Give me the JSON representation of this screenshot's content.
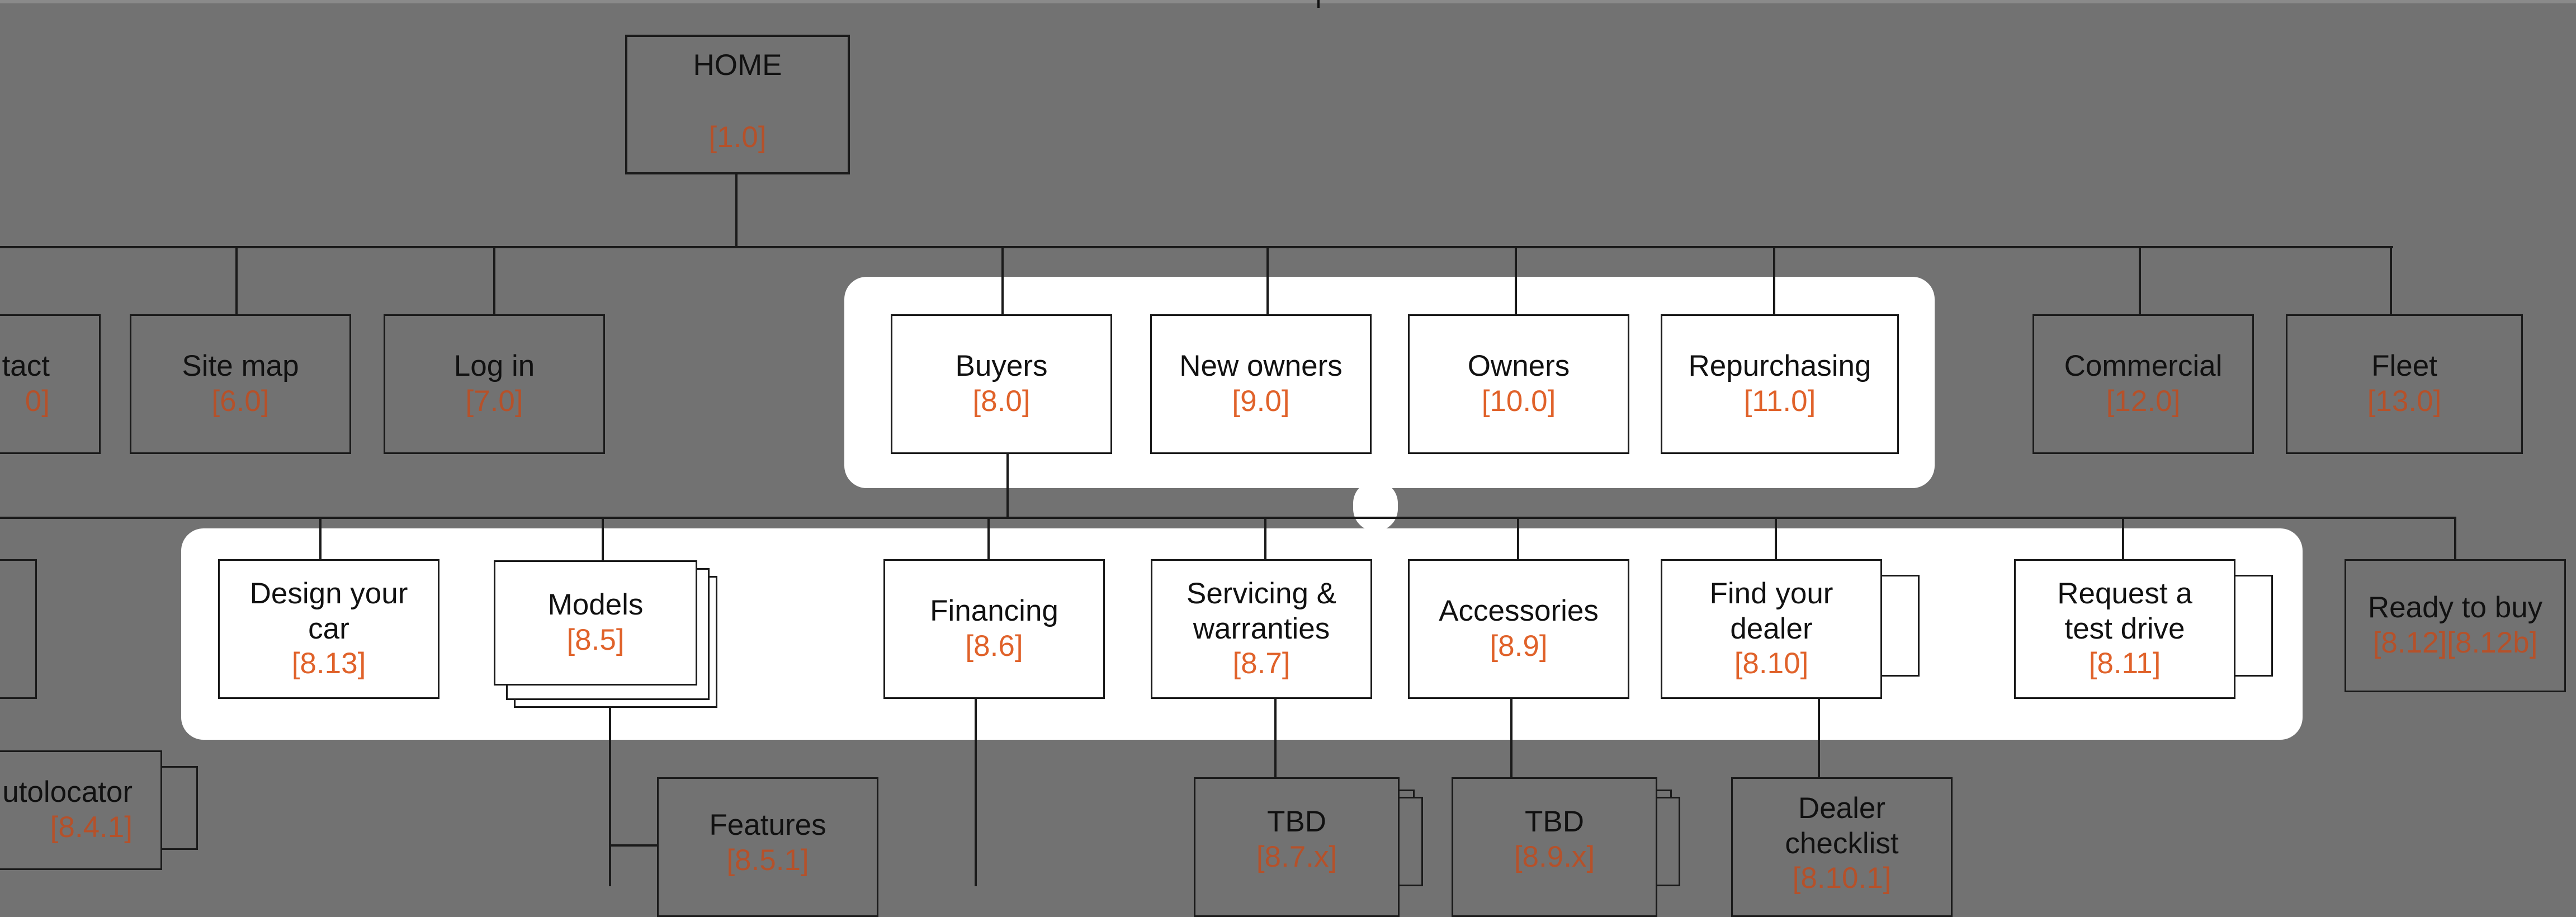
{
  "nodes": {
    "home": {
      "title": "HOME",
      "code": "[1.0]"
    },
    "contact": {
      "title": "tact",
      "code": "0]"
    },
    "site_map": {
      "title": "Site map",
      "code": "[6.0]"
    },
    "log_in": {
      "title": "Log in",
      "code": "[7.0]"
    },
    "buyers": {
      "title": "Buyers",
      "code": "[8.0]"
    },
    "new_owners": {
      "title": "New owners",
      "code": "[9.0]"
    },
    "owners": {
      "title": "Owners",
      "code": "[10.0]"
    },
    "repurchasing": {
      "title": "Repurchasing",
      "code": "[11.0]"
    },
    "commercial": {
      "title": "Commercial",
      "code": "[12.0]"
    },
    "fleet": {
      "title": "Fleet",
      "code": "[13.0]"
    },
    "design_your_car": {
      "title": "Design your car",
      "code": "[8.13]"
    },
    "models": {
      "title": "Models",
      "code": "[8.5]"
    },
    "financing": {
      "title": "Financing",
      "code": "[8.6]"
    },
    "servicing": {
      "title": "Servicing & warranties",
      "code": "[8.7]"
    },
    "accessories": {
      "title": "Accessories",
      "code": "[8.9]"
    },
    "find_your_dealer": {
      "title": "Find your dealer",
      "code": "[8.10]"
    },
    "request_test_drive": {
      "title": "Request a test drive",
      "code": "[8.11]"
    },
    "ready_to_buy": {
      "title": "Ready to buy",
      "code": "[8.12][8.12b]"
    },
    "autolocator": {
      "title": "utolocator",
      "code": "[8.4.1]"
    },
    "features": {
      "title": "Features",
      "code": "[8.5.1]"
    },
    "tbd_servicing": {
      "title": "TBD",
      "code": "[8.7.x]"
    },
    "tbd_accessories": {
      "title": "TBD",
      "code": "[8.9.x]"
    },
    "dealer_checklist": {
      "title": "Dealer checklist",
      "code": "[8.10.1]"
    }
  },
  "colors": {
    "background": "#727272",
    "highlight": "#ffffff",
    "code_text": "#e0622a",
    "line": "#1a1a1a"
  }
}
